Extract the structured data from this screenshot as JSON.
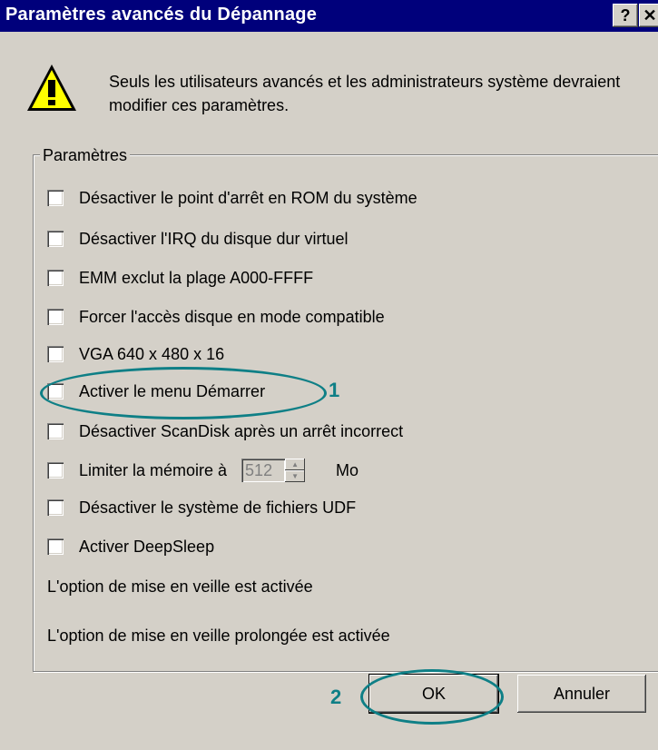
{
  "window": {
    "title": "Paramètres avancés du Dépannage",
    "help_label": "?",
    "close_label": "✕"
  },
  "intro": "Seuls les utilisateurs avancés et les administrateurs système devraient modifier ces paramètres.",
  "group_label": "Paramètres",
  "options": [
    {
      "label": "Désactiver le point d'arrêt en ROM du système",
      "checked": false
    },
    {
      "label": "Désactiver l'IRQ du disque dur virtuel",
      "checked": false
    },
    {
      "label": "EMM exclut la plage A000-FFFF",
      "checked": false
    },
    {
      "label": "Forcer l'accès disque en mode compatible",
      "checked": false
    },
    {
      "label": "VGA 640 x 480 x 16",
      "checked": false
    },
    {
      "label": "Activer le menu Démarrer",
      "checked": false
    },
    {
      "label": "Désactiver ScanDisk après un arrêt incorrect",
      "checked": false
    },
    {
      "label": "Limiter la mémoire à",
      "checked": false
    },
    {
      "label": "Désactiver le système de fichiers UDF",
      "checked": false
    },
    {
      "label": "Activer DeepSleep",
      "checked": false
    }
  ],
  "memory": {
    "value": "512",
    "unit": "Mo"
  },
  "status": [
    "L'option de mise en veille est activée",
    "L'option de mise en veille prolongée est activée"
  ],
  "buttons": {
    "ok": "OK",
    "cancel": "Annuler"
  },
  "annotations": {
    "marker_1": "1",
    "marker_2": "2",
    "color": "#0e7f86"
  }
}
